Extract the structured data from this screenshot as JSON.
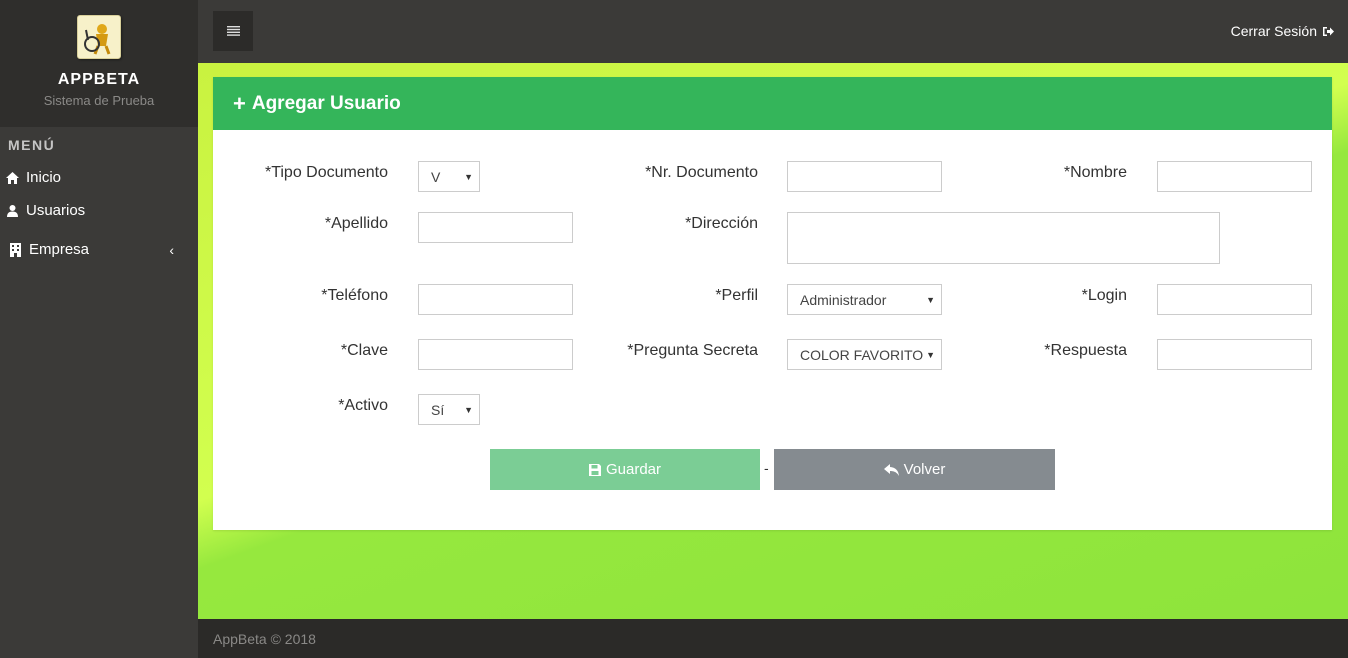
{
  "app": {
    "name": "APPBETA",
    "subtitle": "Sistema de Prueba"
  },
  "sidebar": {
    "menu_title": "MENÚ",
    "items": [
      {
        "label": "Inicio",
        "icon": "home-icon"
      },
      {
        "label": "Usuarios",
        "icon": "user-icon"
      },
      {
        "label": "Empresa",
        "icon": "building-icon",
        "arrow": "‹"
      }
    ]
  },
  "topbar": {
    "logout_label": "Cerrar Sesión"
  },
  "form": {
    "title": "Agregar Usuario",
    "title_icon": "+",
    "fields": {
      "tipo_documento": {
        "label": "*Tipo Documento",
        "value": "V"
      },
      "nr_documento": {
        "label": "*Nr. Documento",
        "value": ""
      },
      "nombre": {
        "label": "*Nombre",
        "value": ""
      },
      "apellido": {
        "label": "*Apellido",
        "value": ""
      },
      "direccion": {
        "label": "*Dirección",
        "value": ""
      },
      "telefono": {
        "label": "*Teléfono",
        "value": ""
      },
      "perfil": {
        "label": "*Perfil",
        "value": "Administrador"
      },
      "login": {
        "label": "*Login",
        "value": ""
      },
      "clave": {
        "label": "*Clave",
        "value": ""
      },
      "pregunta_secreta": {
        "label": "*Pregunta Secreta",
        "value": "COLOR FAVORITO"
      },
      "respuesta": {
        "label": "*Respuesta",
        "value": ""
      },
      "activo": {
        "label": "*Activo",
        "value": "Sí"
      }
    },
    "save_label": "Guardar",
    "separator": "-",
    "back_label": "Volver"
  },
  "footer": {
    "text": "AppBeta © 2018"
  },
  "colors": {
    "panel_header": "#34b55a",
    "save_button": "#7bcd95",
    "back_button": "#858b90",
    "sidebar": "#3b3a38",
    "content_bg": "#c9f240"
  }
}
